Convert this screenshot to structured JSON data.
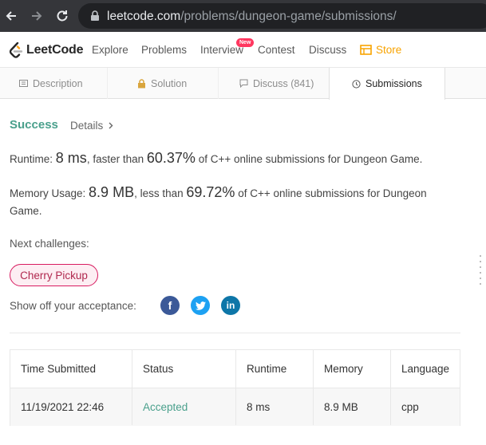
{
  "browser": {
    "url_domain": "leetcode.com",
    "url_path": "/problems/dungeon-game/submissions/"
  },
  "header": {
    "logo_text": "LeetCode",
    "nav": [
      "Explore",
      "Problems",
      "Interview",
      "Contest",
      "Discuss",
      "Store"
    ],
    "new_badge": "New"
  },
  "tabs": [
    "Description",
    "Solution",
    "Discuss (841)",
    "Submissions"
  ],
  "result": {
    "status": "Success",
    "details": "Details"
  },
  "runtime": {
    "label": "Runtime:",
    "value": "8 ms",
    "mid": ", faster than",
    "percent": "60.37%",
    "suffix": "of C++ online submissions for Dungeon Game."
  },
  "memory": {
    "label": "Memory Usage:",
    "value": "8.9 MB",
    "mid": ", less than",
    "percent": "69.72%",
    "suffix": "of C++ online submissions for Dungeon",
    "suffix2": "Game."
  },
  "next": {
    "label": "Next challenges:",
    "chip": "Cherry Pickup"
  },
  "share": {
    "label": "Show off your acceptance:"
  },
  "table": {
    "headers": [
      "Time Submitted",
      "Status",
      "Runtime",
      "Memory",
      "Language"
    ],
    "rows": [
      [
        "11/19/2021 22:46",
        "Accepted",
        "8 ms",
        "8.9 MB",
        "cpp"
      ]
    ]
  },
  "colors": {
    "accent_green": "#4aa08c",
    "store_orange": "#f8a300",
    "chip_pink": "#d81b60",
    "facebook": "#3b5998",
    "twitter": "#1da1f2",
    "linkedin": "#0e76a8"
  }
}
